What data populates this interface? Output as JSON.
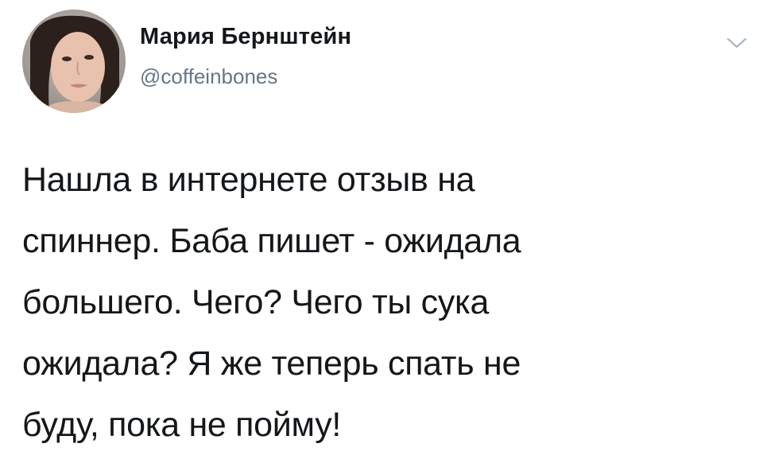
{
  "tweet": {
    "author_name": "Мария Бернштейн",
    "author_handle": "@coffeinbones",
    "avatar_icon": "user-avatar-photo",
    "menu_icon": "chevron-down-icon",
    "text": "Нашла в интернете отзыв на\nспиннер. Баба пишет - ожидала\nбольшего. Чего? Чего ты сука\nожидала? Я же теперь спать не\nбуду, пока не пойму!"
  },
  "colors": {
    "text": "#14171a",
    "secondary": "#657786",
    "chevron": "#aab8c2",
    "background": "#ffffff"
  }
}
